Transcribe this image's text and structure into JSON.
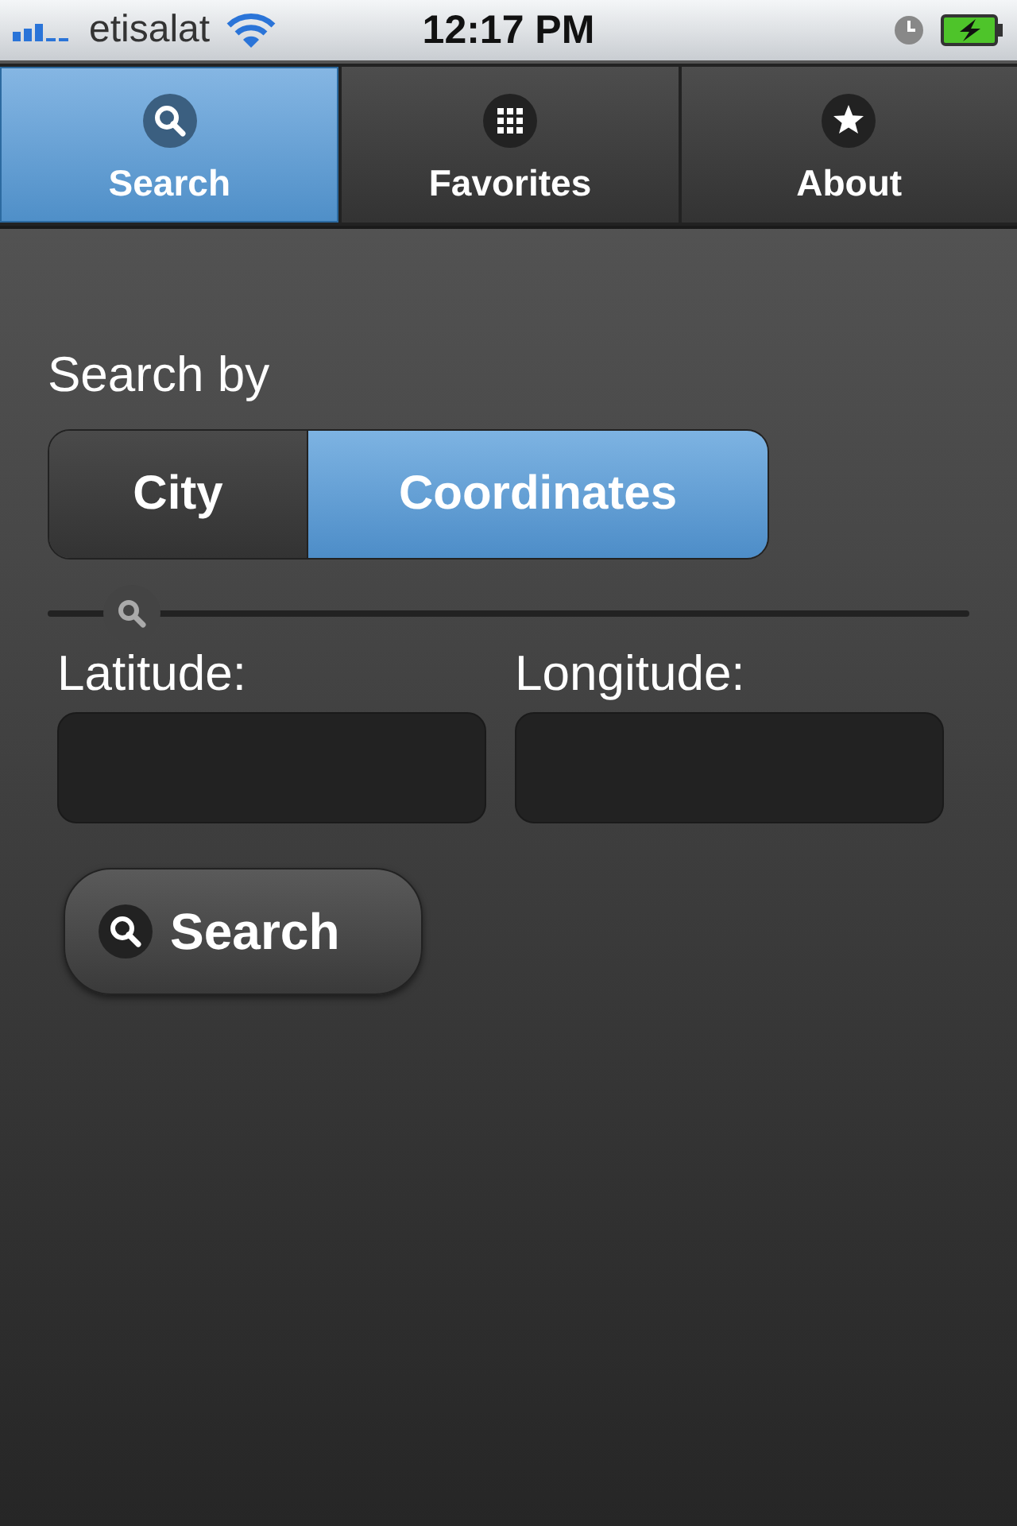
{
  "status_bar": {
    "carrier": "etisalat",
    "time": "12:17 PM"
  },
  "tabs": [
    {
      "label": "Search",
      "kind": "search",
      "selected": true
    },
    {
      "label": "Favorites",
      "kind": "grid",
      "selected": false
    },
    {
      "label": "About",
      "kind": "star",
      "selected": false
    }
  ],
  "search_by": {
    "label": "Search by",
    "options": [
      {
        "label": "City",
        "selected": false
      },
      {
        "label": "Coordinates",
        "selected": true
      }
    ]
  },
  "slider": {
    "level": 0.06
  },
  "fields": [
    {
      "label": "Latitude:"
    },
    {
      "label": "Longitude:"
    }
  ],
  "search_button": {
    "label": "Search"
  }
}
